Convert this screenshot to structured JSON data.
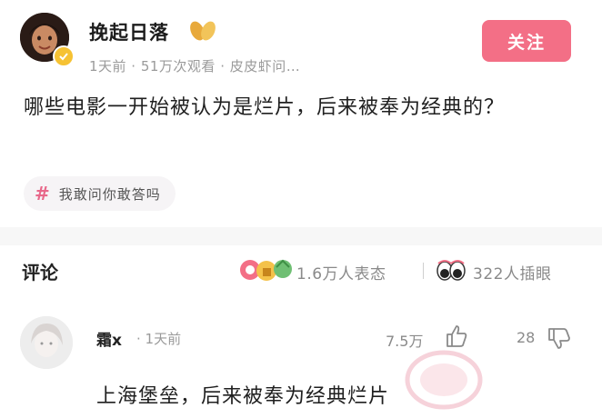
{
  "post": {
    "author": "挽起日落",
    "meta": "1天前 · 51万次观看 · 皮皮虾问…",
    "follow_label": "关注",
    "question": "哪些电影一开始被认为是烂片，后来被奉为经典的？",
    "topic_symbol": "#",
    "topic": "我敢问你敢答吗"
  },
  "comments_header": {
    "title": "评论",
    "reactions": "1.6万人表态",
    "eyes": "322人插眼"
  },
  "comment": {
    "user": "霜x",
    "time": "· 1天前",
    "likes": "7.5万",
    "dislikes": "28",
    "text": "上海堡垒，后来被奉为经典烂片"
  },
  "colors": {
    "accent": "#f36f86",
    "topic_hash": "#e8688a",
    "muted_text": "#9a9a9a"
  },
  "icons": [
    "verified-badge-icon",
    "leaf-badge-icon",
    "hashtag-icon",
    "reaction-icons",
    "eyes-icon",
    "thumb-up-icon",
    "thumb-down-icon"
  ]
}
